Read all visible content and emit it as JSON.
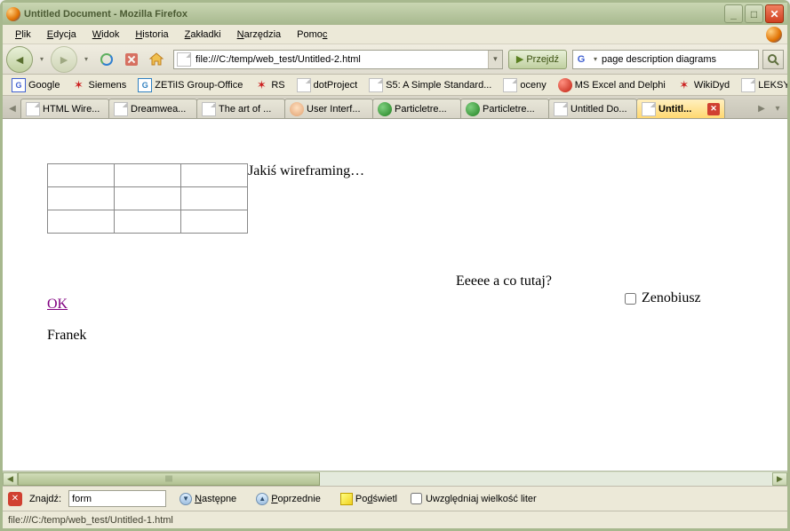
{
  "window": {
    "title": "Untitled Document - Mozilla Firefox"
  },
  "menu": {
    "file": "Plik",
    "edit": "Edycja",
    "view": "Widok",
    "history": "Historia",
    "bookmarks": "Zakładki",
    "tools": "Narzędzia",
    "help": "Pomoc"
  },
  "toolbar": {
    "url": "file:///C:/temp/web_test/Untitled-2.html",
    "go_label": "Przejdź",
    "search_engine": "G",
    "search_value": "page description diagrams"
  },
  "bookmarks": [
    {
      "label": "Google",
      "icon": "g"
    },
    {
      "label": "Siemens",
      "icon": "red"
    },
    {
      "label": "ZETiIS Group-Office",
      "icon": "box"
    },
    {
      "label": "RS",
      "icon": "red"
    },
    {
      "label": "dotProject",
      "icon": "page"
    },
    {
      "label": "S5: A Simple Standard...",
      "icon": "page"
    },
    {
      "label": "oceny",
      "icon": "page"
    },
    {
      "label": "MS Excel and Delphi",
      "icon": "ball"
    },
    {
      "label": "WikiDyd",
      "icon": "red"
    },
    {
      "label": "LEKSYKA.PL",
      "icon": "page"
    }
  ],
  "tabs": [
    {
      "label": "HTML Wire...",
      "icon": "page"
    },
    {
      "label": "Dreamwea...",
      "icon": "page"
    },
    {
      "label": "The art of ...",
      "icon": "page"
    },
    {
      "label": "User Interf...",
      "icon": "face"
    },
    {
      "label": "Particletre...",
      "icon": "green"
    },
    {
      "label": "Particletre...",
      "icon": "green"
    },
    {
      "label": "Untitled Do...",
      "icon": "page"
    },
    {
      "label": "Untitl...",
      "icon": "page",
      "active": true
    }
  ],
  "page": {
    "wireframe_label": "Jakiś wireframing…",
    "mid_text": "Eeeee a co tutaj?",
    "ok_link": "OK",
    "checkbox_label": "Zenobiusz",
    "name_text": "Franek"
  },
  "findbar": {
    "label": "Znajdź:",
    "value": "form",
    "next": "Następne",
    "prev": "Poprzednie",
    "highlight": "Podświetl",
    "matchcase": "Uwzględniaj wielkość liter"
  },
  "status": {
    "text": "file:///C:/temp/web_test/Untitled-1.html"
  }
}
